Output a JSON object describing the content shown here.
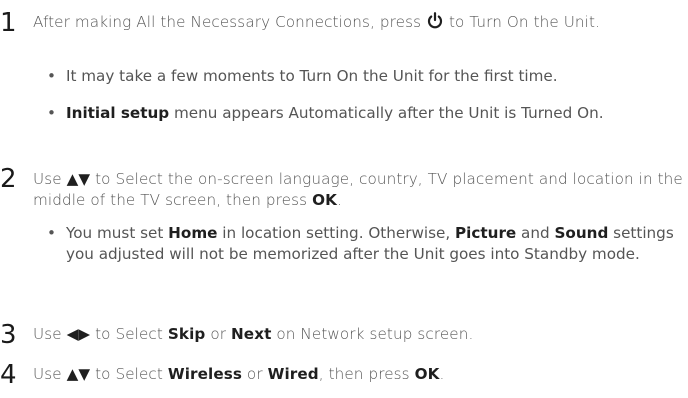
{
  "steps": [
    {
      "number": "1",
      "text_a": "After making All the Necessary Connections, press ",
      "text_b": " to Turn On the Unit.",
      "bullets": [
        {
          "dot": "•",
          "text": "It may take a few moments to Turn On the Unit for the first time."
        },
        {
          "dot": "•",
          "bold": "Initial setup",
          "text": " menu appears Automatically after the Unit is Turned On."
        }
      ]
    },
    {
      "number": "2",
      "text_a": "Use ",
      "symbol": "▲▼",
      "text_b": " to Select the on-screen language, country, TV placement and location in the middle of the TV screen, then press ",
      "bold_end": "OK",
      "text_c": ".",
      "bullets": [
        {
          "dot": "•",
          "t1": "You must set ",
          "b1": "Home",
          "t2": " in location setting. Otherwise, ",
          "b2": "Picture",
          "t3": " and ",
          "b3": "Sound",
          "t4": " settings you adjusted will not be memorized after the Unit goes into Standby mode."
        }
      ]
    },
    {
      "number": "3",
      "text_a": "Use ",
      "symbol": "◀▶",
      "text_b": " to Select ",
      "b1": "Skip",
      "text_c": " or ",
      "b2": "Next",
      "text_d": " on Network setup screen."
    },
    {
      "number": "4",
      "text_a": "Use ",
      "symbol": "▲▼",
      "text_b": " to Select ",
      "b1": "Wireless",
      "text_c": " or ",
      "b2": "Wired",
      "text_d": ", then press ",
      "b3": "OK",
      "text_e": "."
    }
  ],
  "icons": {
    "power": "power-icon"
  }
}
